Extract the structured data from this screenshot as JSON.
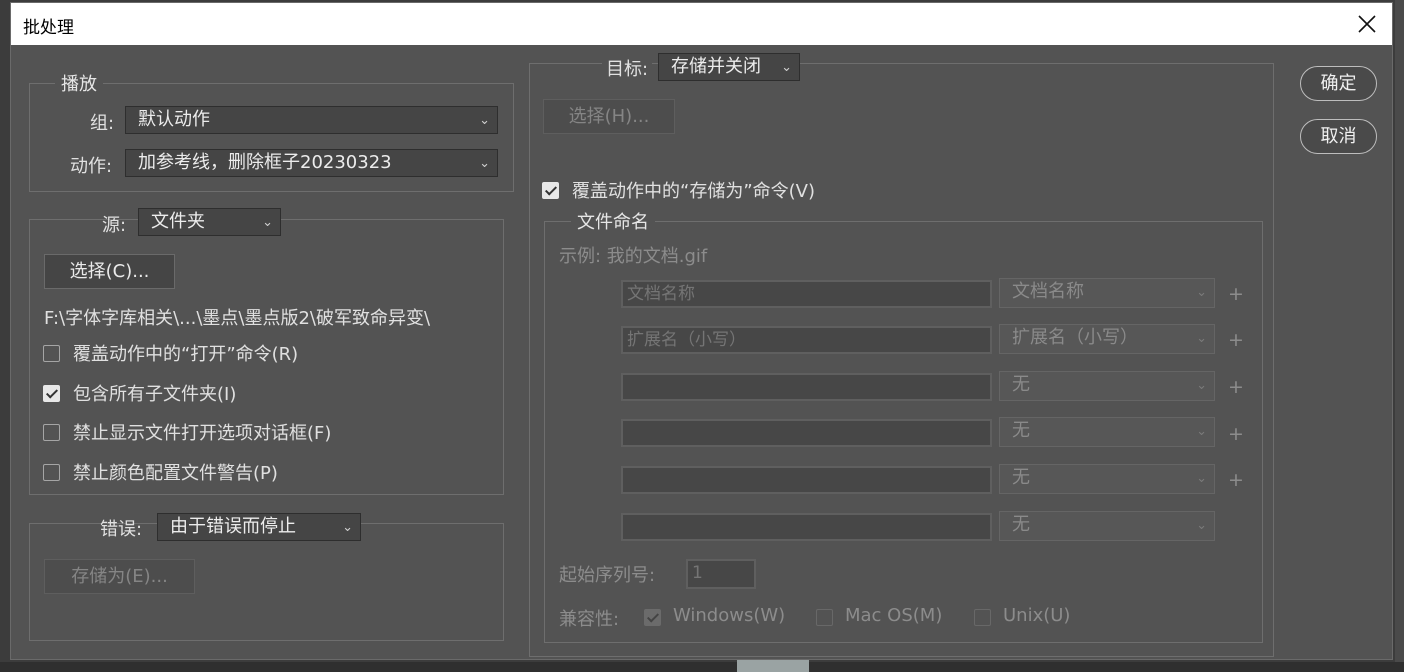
{
  "window": {
    "title": "批处理"
  },
  "buttons": {
    "ok": "确定",
    "cancel": "取消"
  },
  "play": {
    "legend": "播放",
    "set_label": "组:",
    "set_value": "默认动作",
    "action_label": "动作:",
    "action_value": "加参考线，删除框子20230323"
  },
  "source": {
    "label": "源:",
    "value": "文件夹",
    "choose_button": "选择(C)...",
    "path": "F:\\字体字库相关\\...\\墨点\\墨点版2\\破军致命异变\\",
    "options": [
      {
        "label": "覆盖动作中的“打开”命令(R)",
        "checked": false
      },
      {
        "label": "包含所有子文件夹(I)",
        "checked": true
      },
      {
        "label": "禁止显示文件打开选项对话框(F)",
        "checked": false
      },
      {
        "label": "禁止颜色配置文件警告(P)",
        "checked": false
      }
    ]
  },
  "errors": {
    "label": "错误:",
    "value": "由于错误而停止",
    "save_as_button": "存储为(E)..."
  },
  "destination": {
    "label": "目标:",
    "value": "存储并关闭",
    "choose_button": "选择(H)...",
    "override_save_as": {
      "label": "覆盖动作中的“存储为”命令(V)",
      "checked": true
    }
  },
  "file_naming": {
    "legend": "文件命名",
    "example": "示例: 我的文档.gif",
    "rows": [
      {
        "field": "文档名称",
        "select": "文档名称"
      },
      {
        "field": "扩展名（小写）",
        "select": "扩展名（小写）"
      },
      {
        "field": "",
        "select": "无"
      },
      {
        "field": "",
        "select": "无"
      },
      {
        "field": "",
        "select": "无"
      },
      {
        "field": "",
        "select": "无"
      }
    ],
    "plus_symbol": "+",
    "serial_label": "起始序列号:",
    "serial_value": "1",
    "compat_label": "兼容性:",
    "compat": [
      {
        "label": "Windows(W)",
        "checked": true
      },
      {
        "label": "Mac OS(M)",
        "checked": false
      },
      {
        "label": "Unix(U)",
        "checked": false
      }
    ]
  }
}
